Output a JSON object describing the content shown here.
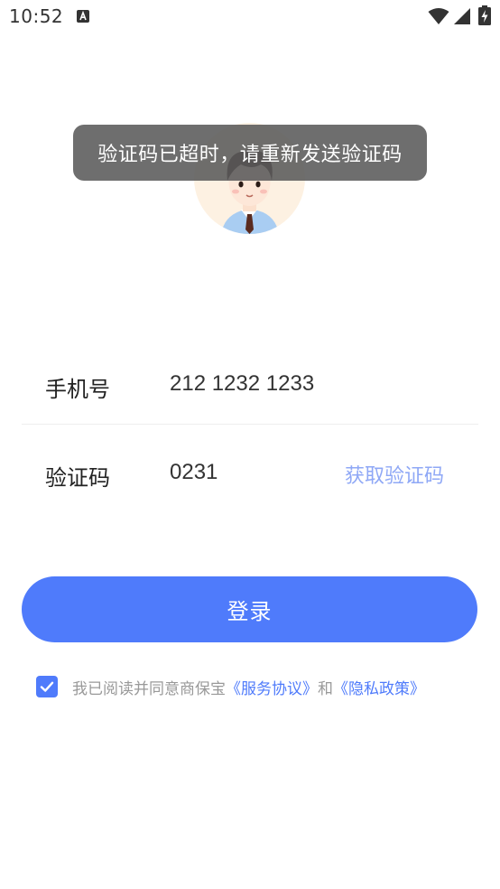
{
  "status_bar": {
    "time": "10:52",
    "icons": [
      "notification-a-icon",
      "wifi-icon",
      "signal-icon",
      "battery-charging-icon"
    ]
  },
  "toast": {
    "message": "验证码已超时，请重新发送验证码"
  },
  "form": {
    "phone": {
      "label": "手机号",
      "value": "212 1232 1233"
    },
    "code": {
      "label": "验证码",
      "value": "0231",
      "get_code_label": "获取验证码"
    }
  },
  "login_button": {
    "label": "登录"
  },
  "agreement": {
    "checked": true,
    "prefix": "我已阅读并同意商保宝",
    "service_link": "《服务协议》",
    "and_text": "和",
    "privacy_link": "《隐私政策》"
  },
  "colors": {
    "accent": "#4f7bfb",
    "get_code": "#8fa8f6",
    "toast_bg": "#5a5a5a",
    "avatar_bg": "#fdf1e2"
  }
}
